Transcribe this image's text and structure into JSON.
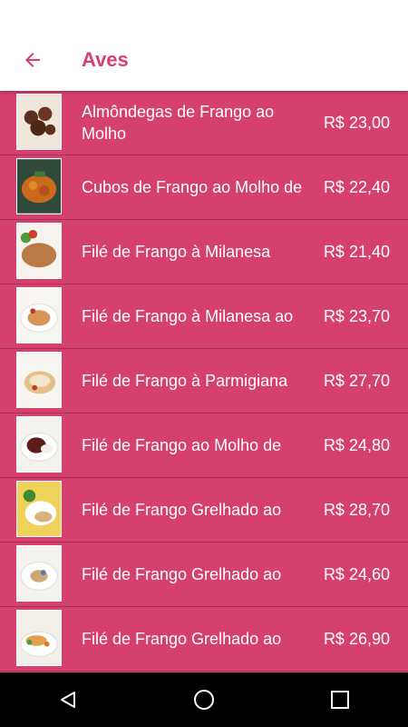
{
  "header": {
    "title": "Aves",
    "back_icon": "arrow-back-icon"
  },
  "colors": {
    "accent": "#d6406f",
    "divider": "#a92e55",
    "text_on_accent": "#ffffff"
  },
  "items": [
    {
      "name": "Almôndegas de Frango ao Molho",
      "price": "R$ 23,00"
    },
    {
      "name": "Cubos de Frango ao Molho de",
      "price": "R$ 22,40"
    },
    {
      "name": "Filé de Frango à Milanesa",
      "price": "R$ 21,40"
    },
    {
      "name": "Filé de Frango à Milanesa ao",
      "price": "R$ 23,70"
    },
    {
      "name": "Filé de Frango à Parmigiana",
      "price": "R$ 27,70"
    },
    {
      "name": "Filé de Frango ao Molho de",
      "price": "R$ 24,80"
    },
    {
      "name": "Filé de Frango Grelhado ao",
      "price": "R$ 28,70"
    },
    {
      "name": "Filé de Frango Grelhado ao",
      "price": "R$ 24,60"
    },
    {
      "name": "Filé de Frango Grelhado ao",
      "price": "R$ 26,90"
    }
  ],
  "navbar": {
    "back": "nav-back-icon",
    "home": "nav-home-icon",
    "recents": "nav-recents-icon"
  }
}
